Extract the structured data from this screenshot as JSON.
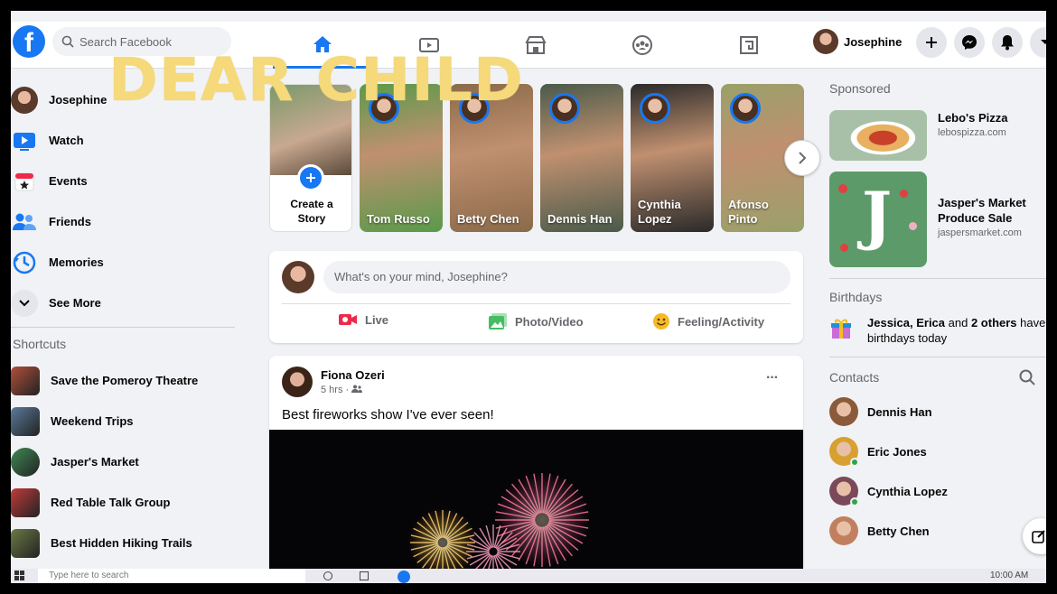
{
  "topbar": {
    "logo": "f",
    "search_placeholder": "Search Facebook",
    "profile_name": "Josephine",
    "nav_tabs": [
      "home-icon",
      "watch-icon",
      "marketplace-icon",
      "groups-icon",
      "gaming-icon"
    ]
  },
  "overlay_text": "DEAR CHILD",
  "sidebar": {
    "items": [
      {
        "label": "Josephine",
        "icon": "avatar"
      },
      {
        "label": "Watch",
        "icon": "watch-icon"
      },
      {
        "label": "Events",
        "icon": "events-icon"
      },
      {
        "label": "Friends",
        "icon": "friends-icon"
      },
      {
        "label": "Memories",
        "icon": "memories-icon"
      },
      {
        "label": "See More",
        "icon": "chevron-down-icon"
      }
    ],
    "shortcuts_title": "Shortcuts",
    "shortcuts": [
      {
        "label": "Save the Pomeroy Theatre",
        "color": "#b0503a"
      },
      {
        "label": "Weekend Trips",
        "color": "#5a7a9a"
      },
      {
        "label": "Jasper's Market",
        "color": "#3f8a55"
      },
      {
        "label": "Red Table Talk Group",
        "color": "#c23b3b"
      },
      {
        "label": "Best Hidden Hiking Trails",
        "color": "#6b7a45"
      }
    ]
  },
  "stories": {
    "create_label": "Create a Story",
    "items": [
      {
        "name": "Tom Russo",
        "color": "#5a9a4a"
      },
      {
        "name": "Betty Chen",
        "color": "#8a6a4a"
      },
      {
        "name": "Dennis Han",
        "color": "#4a5a4a"
      },
      {
        "name": "Cynthia Lopez",
        "color": "#2a2a2a"
      },
      {
        "name": "Afonso Pinto",
        "color": "#9aa06a"
      }
    ]
  },
  "composer": {
    "placeholder": "What's on your mind, Josephine?",
    "actions": [
      {
        "label": "Live",
        "icon": "live-video-icon",
        "color": "#f02849"
      },
      {
        "label": "Photo/Video",
        "icon": "photo-icon",
        "color": "#45bd62"
      },
      {
        "label": "Feeling/Activity",
        "icon": "feeling-icon",
        "color": "#f7b928"
      }
    ]
  },
  "post": {
    "author": "Fiona Ozeri",
    "time": "5 hrs · ",
    "text": "Best fireworks show I've ever seen!",
    "more": "···"
  },
  "right": {
    "sponsored_title": "Sponsored",
    "ads": [
      {
        "title": "Lebo's Pizza",
        "url": "lebospizza.com"
      },
      {
        "title": "Jasper's Market Produce Sale",
        "url": "jaspersmarket.com"
      }
    ],
    "birthdays_title": "Birthdays",
    "birthdays_bold": "Jessica, Erica",
    "birthdays_mid": " and ",
    "birthdays_bold2": "2 others",
    "birthdays_rest": " have birthdays today",
    "contacts_title": "Contacts",
    "contacts": [
      {
        "name": "Dennis Han",
        "online": false,
        "color": "#8a5a3a"
      },
      {
        "name": "Eric Jones",
        "online": true,
        "color": "#d8a030"
      },
      {
        "name": "Cynthia Lopez",
        "online": true,
        "color": "#7a4a5a"
      },
      {
        "name": "Betty Chen",
        "online": false,
        "color": "#c08060"
      }
    ]
  },
  "taskbar": {
    "search_placeholder": "Type here to search",
    "time": "10:00 AM"
  },
  "colors": {
    "brand": "#1877f2",
    "background": "#f0f2f5",
    "overlay": "#f5d97a"
  }
}
